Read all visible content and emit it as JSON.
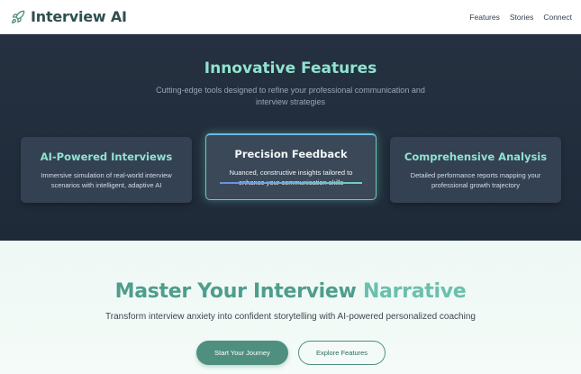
{
  "header": {
    "brand": "Interview AI",
    "brand_icon": "rocket-icon",
    "nav": [
      "Features",
      "Stories",
      "Connect"
    ]
  },
  "features": {
    "title": "Innovative Features",
    "subtitle": "Cutting-edge tools designed to refine your professional communication and interview strategies",
    "cards": [
      {
        "title": "AI-Powered Interviews",
        "description": "Immersive simulation of real-world interview scenarios with intelligent, adaptive AI"
      },
      {
        "title": "Precision Feedback",
        "description": "Nuanced, constructive insights tailored to enhance your communication skills"
      },
      {
        "title": "Comprehensive Analysis",
        "description": "Detailed performance reports mapping your professional growth trajectory"
      }
    ]
  },
  "hero": {
    "title_part1": "Master Your Interview",
    "title_part2": "Narrative",
    "subtitle": "Transform interview anxiety into confident storytelling with AI-powered personalized coaching",
    "primary_button": "Start Your Journey",
    "secondary_button": "Explore Features"
  },
  "colors": {
    "accent": "#8fe3cf",
    "brand_dark": "#2f4f4f",
    "primary_button": "#4f8f7f",
    "features_bg": "#253140"
  }
}
